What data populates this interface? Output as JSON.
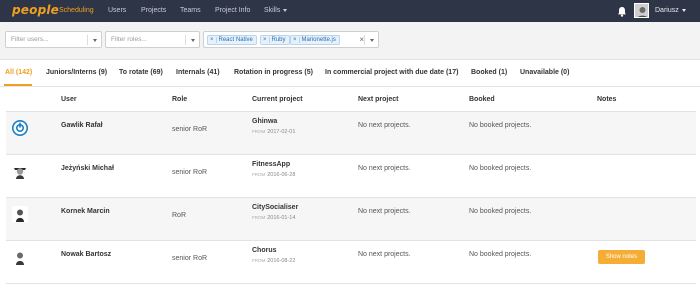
{
  "nav": {
    "brand": "people",
    "links": [
      "Scheduling",
      "Users",
      "Projects",
      "Teams",
      "Project Info",
      "Skills"
    ],
    "active": "Scheduling",
    "user_name": "Dariusz"
  },
  "filters": {
    "users_placeholder": "Filter users...",
    "roles_placeholder": "Filter roles...",
    "skill_tags": [
      "React Native",
      "Ruby",
      "Marionette.js"
    ],
    "clear_symbol": "×"
  },
  "tabs": [
    {
      "label": "All (142)",
      "active": true
    },
    {
      "label": "Juniors/Interns (9)",
      "active": false
    },
    {
      "label": "To rotate (69)",
      "active": false
    },
    {
      "label": "Internals (41)",
      "active": false
    },
    {
      "label": "Rotation in progress (5)",
      "active": false
    },
    {
      "label": "In commercial project with due date (17)",
      "active": false
    },
    {
      "label": "Booked (1)",
      "active": false
    },
    {
      "label": "Unavailable (0)",
      "active": false
    }
  ],
  "table": {
    "headers": {
      "user": "User",
      "role": "Role",
      "current_project": "Current project",
      "next_project": "Next project",
      "booked": "Booked",
      "notes": "Notes"
    },
    "from_label": "FROM",
    "rows": [
      {
        "user": "Gawlik Rafał",
        "role": "senior RoR",
        "project": "Ghinwa",
        "from": "2017-02-01",
        "next": "No next projects.",
        "booked": "No booked projects.",
        "notes_button": ""
      },
      {
        "user": "Jeżyński Michał",
        "role": "senior RoR",
        "project": "FitnessApp",
        "from": "2016-06-28",
        "next": "No next projects.",
        "booked": "No booked projects.",
        "notes_button": ""
      },
      {
        "user": "Kornek Marcin",
        "role": "RoR",
        "project": "CitySocialiser",
        "from": "2016-01-14",
        "next": "No next projects.",
        "booked": "No booked projects.",
        "notes_button": ""
      },
      {
        "user": "Nowak Bartosz",
        "role": "senior RoR",
        "project": "Chorus",
        "from": "2016-08-22",
        "next": "No next projects.",
        "booked": "No booked projects.",
        "notes_button": "Show notes"
      }
    ]
  },
  "colors": {
    "navbar_bg": "#2d3546",
    "accent": "#f0a020",
    "tag_bg": "#e6f1fb",
    "row_alt": "#f6f6f6"
  }
}
